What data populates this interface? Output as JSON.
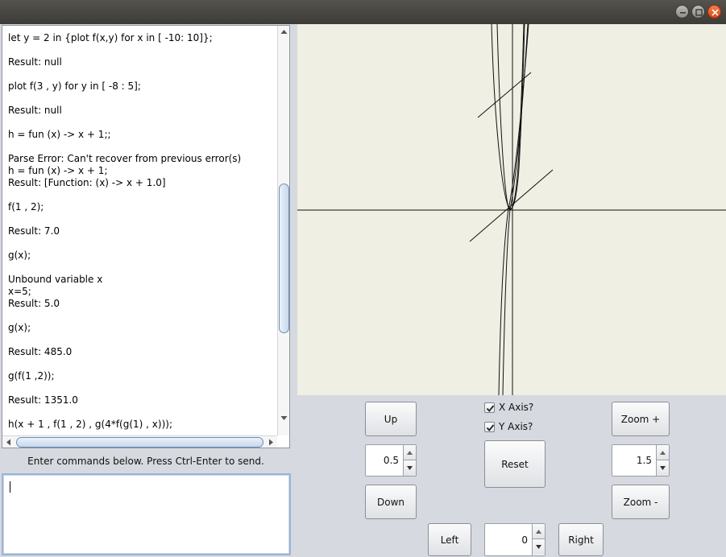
{
  "console": {
    "lines": [
      "let y = 2 in {plot f(x,y) for x in [ -10: 10]};",
      "",
      "Result: null",
      "",
      "plot f(3 , y) for y in [ -8 : 5];",
      "",
      "Result: null",
      "",
      "h = fun (x) -> x + 1;;",
      "",
      "Parse Error: Can't recover from previous error(s)",
      "h = fun (x) -> x + 1;",
      "Result: [Function: (x) -> x + 1.0]",
      "",
      "f(1 , 2);",
      "",
      "Result: 7.0",
      "",
      "g(x);",
      "",
      "Unbound variable x",
      "x=5;",
      "Result: 5.0",
      "",
      "g(x);",
      "",
      "Result: 485.0",
      "",
      "g(f(1 ,2));",
      "",
      "Result: 1351.0",
      "",
      "h(x + 1 , f(1 , 2) , g(4*f(g(1) , x)));"
    ],
    "text": ""
  },
  "hint": "Enter commands below.  Press Ctrl-Enter to send.",
  "input": {
    "value": ""
  },
  "controls": {
    "up_label": "Up",
    "down_label": "Down",
    "left_label": "Left",
    "right_label": "Right",
    "zoom_in_label": "Zoom +",
    "zoom_out_label": "Zoom -",
    "reset_label": "Reset",
    "x_axis_label": "X Axis?",
    "y_axis_label": "Y Axis?",
    "x_axis_checked": true,
    "y_axis_checked": true,
    "vertical_step": "0.5",
    "zoom_factor": "1.5",
    "horizontal_offset": "0"
  },
  "colors": {
    "plot_background": "#f0efe4",
    "curve": "#111111",
    "window_close": "#e95420"
  }
}
